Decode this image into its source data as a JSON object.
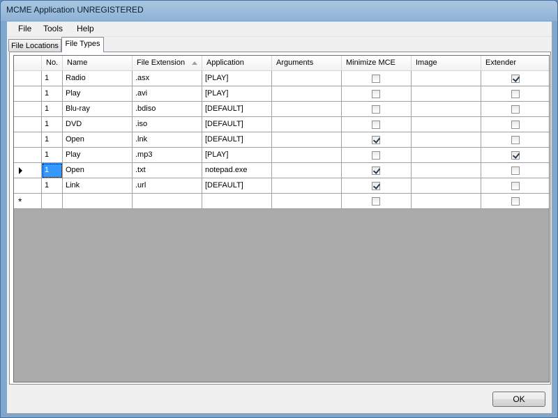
{
  "window": {
    "title": "MCME Application UNREGISTERED"
  },
  "menu": [
    "File",
    "Tools",
    "Help"
  ],
  "tabs": [
    {
      "label": "File Locations",
      "active": false
    },
    {
      "label": "File Types",
      "active": true
    }
  ],
  "grid": {
    "columns": [
      "No.",
      "Name",
      "File Extension",
      "Application",
      "Arguments",
      "Minimize MCE",
      "Image",
      "Extender"
    ],
    "sorted_column": "File Extension",
    "sort_direction": "ascending",
    "rows": [
      {
        "no": "1",
        "name": "Radio",
        "ext": ".asx",
        "app": "[PLAY]",
        "args": "",
        "minimize": false,
        "image": "",
        "extender": true
      },
      {
        "no": "1",
        "name": "Play",
        "ext": ".avi",
        "app": "[PLAY]",
        "args": "",
        "minimize": false,
        "image": "",
        "extender": false
      },
      {
        "no": "1",
        "name": "Blu-ray",
        "ext": ".bdiso",
        "app": "[DEFAULT]",
        "args": "",
        "minimize": false,
        "image": "",
        "extender": false
      },
      {
        "no": "1",
        "name": "DVD",
        "ext": ".iso",
        "app": "[DEFAULT]",
        "args": "",
        "minimize": false,
        "image": "",
        "extender": false
      },
      {
        "no": "1",
        "name": "Open",
        "ext": ".lnk",
        "app": "[DEFAULT]",
        "args": "",
        "minimize": true,
        "image": "",
        "extender": false
      },
      {
        "no": "1",
        "name": "Play",
        "ext": ".mp3",
        "app": "[PLAY]",
        "args": "",
        "minimize": false,
        "image": "",
        "extender": true
      },
      {
        "no": "1",
        "name": "Open",
        "ext": ".txt",
        "app": "notepad.exe",
        "args": "",
        "minimize": true,
        "image": "",
        "extender": false,
        "current": true
      },
      {
        "no": "1",
        "name": "Link",
        "ext": ".url",
        "app": "[DEFAULT]",
        "args": "",
        "minimize": true,
        "image": "",
        "extender": false
      }
    ],
    "new_row_marker": "*"
  },
  "buttons": {
    "ok": "OK"
  }
}
